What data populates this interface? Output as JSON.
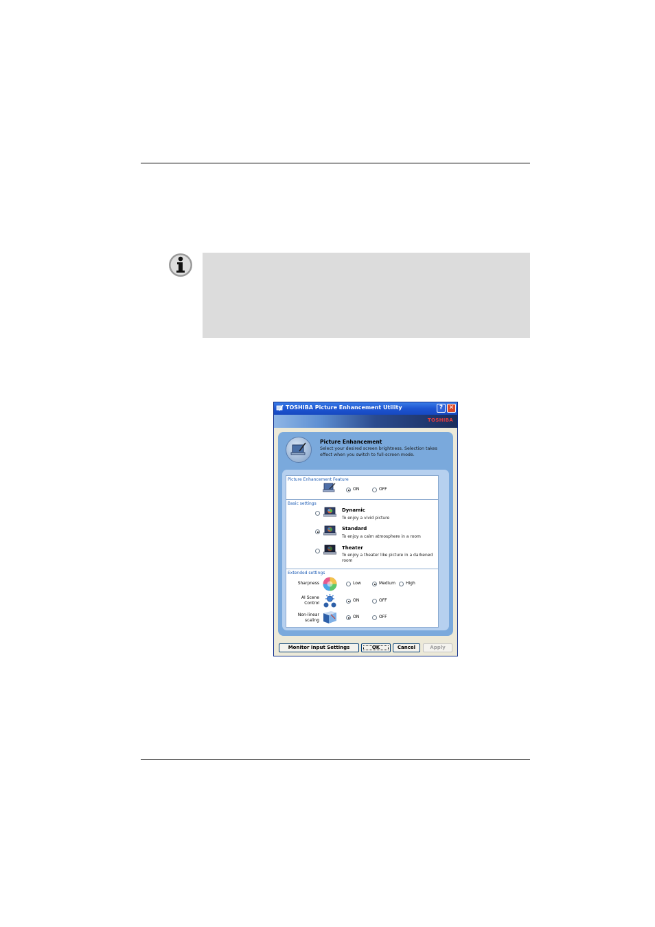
{
  "window": {
    "title": "TOSHIBA Picture Enhancement Utility",
    "brand": "TOSHIBA",
    "help_glyph": "?",
    "close_glyph": "✕"
  },
  "header": {
    "title": "Picture Enhancement",
    "description": "Select your desired screen brightness. Selection takes effect when you switch to full-screen mode."
  },
  "feature": {
    "section_label": "Picture Enhancement Feature",
    "on_label": "ON",
    "off_label": "OFF",
    "selected": "ON"
  },
  "basic": {
    "section_label": "Basic settings",
    "selected": "Standard",
    "options": [
      {
        "name": "Dynamic",
        "desc": "To enjoy a vivid picture"
      },
      {
        "name": "Standard",
        "desc": "To enjoy a calm atmosphere in a room"
      },
      {
        "name": "Theater",
        "desc": "To enjoy a theater like picture in a darkened room"
      }
    ]
  },
  "extended": {
    "section_label": "Extended settings",
    "sharpness": {
      "label": "Sharpness",
      "options": [
        "Low",
        "Medium",
        "High"
      ],
      "selected": "Medium"
    },
    "ai_scene": {
      "label": "AI Scene Control",
      "on_label": "ON",
      "off_label": "OFF",
      "selected": "ON"
    },
    "nonlinear": {
      "label": "Non-linear scaling",
      "on_label": "ON",
      "off_label": "OFF",
      "selected": "ON"
    }
  },
  "buttons": {
    "monitor": "Monitor Input Settings",
    "ok": "OK",
    "cancel": "Cancel",
    "apply": "Apply"
  },
  "colors": {
    "title_bar": "#1d55d2",
    "brand_red": "#e83c3c",
    "note_box": "#dcdcdc"
  }
}
